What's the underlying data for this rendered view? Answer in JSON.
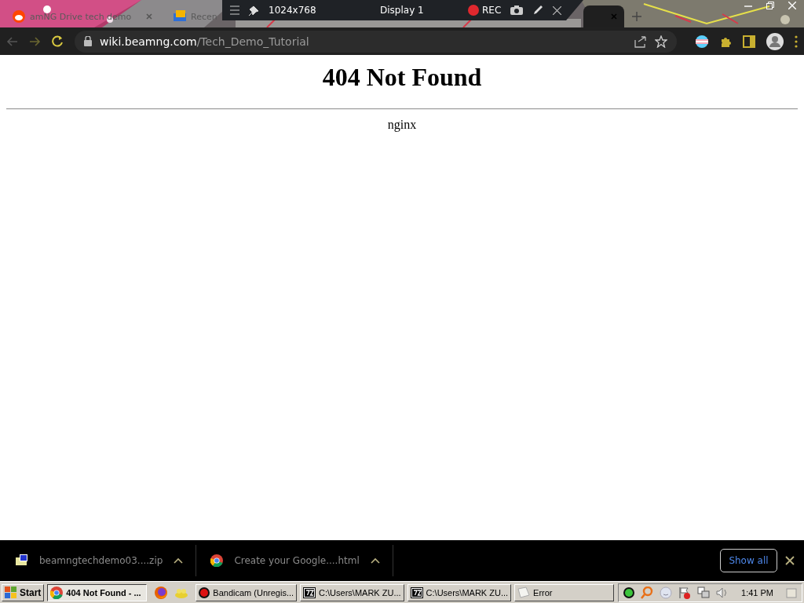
{
  "browser": {
    "tabs": [
      {
        "title": "amNG Drive tech demo",
        "selected": false
      },
      {
        "title": "Recen",
        "selected": false
      },
      {
        "selected": true
      }
    ],
    "address": {
      "host": "wiki.beamng.com",
      "path": "/Tech_Demo_Tutorial"
    }
  },
  "recorder": {
    "resolution": "1024x768",
    "display": "Display 1",
    "record_label": "REC"
  },
  "page": {
    "heading": "404 Not Found",
    "server": "nginx"
  },
  "downloads": {
    "items": [
      {
        "name": "beamngtechdemo03....zip"
      },
      {
        "name": "Create your Google....html"
      }
    ],
    "show_all": "Show all"
  },
  "taskbar": {
    "start": "Start",
    "buttons": [
      {
        "label": "404 Not Found - ...",
        "selected": true
      },
      {
        "label": "Bandicam (Unregis...",
        "selected": false
      },
      {
        "label": "C:\\Users\\MARK ZU...",
        "selected": false
      },
      {
        "label": "C:\\Users\\MARK ZU...",
        "selected": false
      },
      {
        "label": "Error",
        "selected": false
      }
    ],
    "clock": "1:41 PM"
  }
}
